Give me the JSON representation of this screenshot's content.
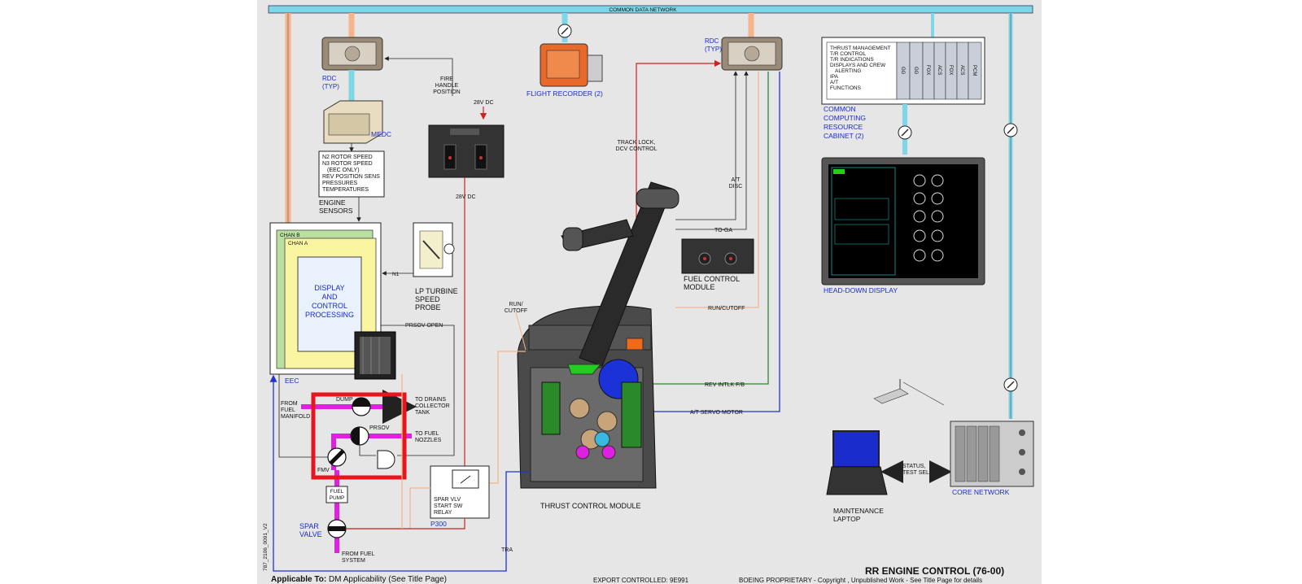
{
  "title": "RR ENGINE CONTROL (76-00)",
  "footer": {
    "applicable_label": "Applicable To:",
    "applicable_value": "DM Applicability (See Title Page)",
    "export": "EXPORT CONTROLLED: 9E991",
    "proprietary": "BOEING PROPRIETARY - Copyright , Unpublished Work - See Title Page for details",
    "drawing_id": "787_2106_0091_V2"
  },
  "bus": {
    "label": "COMMON DATA NETWORK"
  },
  "components": {
    "rdc_left": "RDC\n(TYP)",
    "rdc_right": "RDC\n(TYP)",
    "medc": "MEDC",
    "flight_recorder": "FLIGHT RECORDER (2)",
    "ccr": "COMMON\nCOMPUTING\nRESOURCE\nCABINET (2)",
    "head_down_display": "HEAD-DOWN DISPLAY",
    "engine_sensors": "ENGINE\nSENSORS",
    "lp_probe": "LP TURBINE\nSPEED\nPROBE",
    "eec": "EEC",
    "chan_b": "CHAN B",
    "chan_a": "CHAN A",
    "dcp": "DISPLAY\nAND\nCONTROL\nPROCESSING",
    "fuel_control_module": "FUEL CONTROL\nMODULE",
    "thrust_control_module": "THRUST CONTROL MODULE",
    "spar_valve": "SPAR\nVALVE",
    "spar_relay": "SPAR VLV\nSTART SW\nRELAY",
    "p300": "P300",
    "core_network": "CORE NETWORK",
    "maintenance_laptop": "MAINTENANCE\nLAPTOP",
    "fuel_pump": "FUEL\nPUMP",
    "fmv": "FMV",
    "dump": "DUMP",
    "prsov": "PRSOV"
  },
  "sensor_list": [
    "N2 ROTOR SPEED",
    "N3 ROTOR SPEED",
    "(EEC ONLY)",
    "REV POSITION SENS",
    "PRESSURES",
    "TEMPERATURES"
  ],
  "ccr_functions": [
    "THRUST MANAGEMENT",
    "T/R CONTROL",
    "T/R INDICATIONS",
    "DISPLAYS AND CREW",
    "ALERTING",
    "IPA",
    "A/T",
    "",
    "FUNCTIONS"
  ],
  "ccr_cards": [
    "GG",
    "GG",
    "FOX",
    "ACS",
    "FOX",
    "ACS",
    "PCM"
  ],
  "signals": {
    "fire_handle": "FIRE\nHANDLE\nPOSITION",
    "dc28_top": "28V DC",
    "dc28_bottom": "28V DC",
    "track_lock": "TRACK LOCK,\nDCV CONTROL",
    "at_disc": "A/T\nDISC",
    "to_ga": "TO-GA",
    "run_cutoff_left": "RUN/\nCUTOFF",
    "run_cutoff_right": "RUN/CUTOFF",
    "rev_intlk": "REV INTLK F/B",
    "at_servo": "A/T SERVO MOTOR",
    "n1": "N1",
    "prsov_open": "PRSOV OPEN",
    "from_fuel_manifold": "FROM\nFUEL\nMANIFOLD",
    "to_drains": "TO DRAINS\nCOLLECTOR\nTANK",
    "to_fuel_nozzles": "TO FUEL\nNOZZLES",
    "from_fuel_system": "FROM FUEL\nSYSTEM",
    "tra": "TRA",
    "status_test": "STATUS,\nTEST SEL"
  },
  "colors": {
    "bus": "#7fd6e6",
    "fuel": "#e020e0",
    "fire_power": "#cc2222",
    "run_cutoff": "#f5b48a",
    "rev_intlk": "#2a8a2a",
    "servo": "#2233cc",
    "highlight": "#e8141e",
    "label_blue": "#1a2ccc"
  }
}
